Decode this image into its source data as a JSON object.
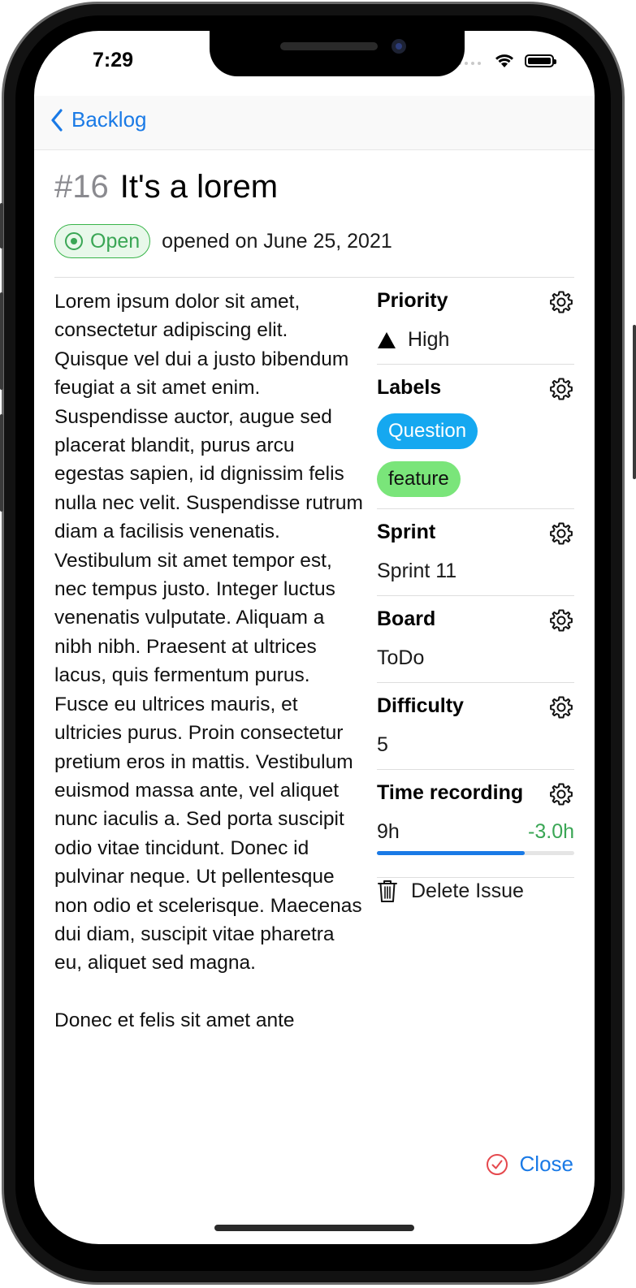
{
  "status_bar": {
    "time": "7:29"
  },
  "nav": {
    "back_label": "Backlog"
  },
  "issue": {
    "number": "#16",
    "title": "It's a lorem",
    "status": "Open",
    "opened_text": "opened on June 25, 2021",
    "body_paragraphs": [
      "Lorem ipsum dolor sit amet, consectetur adipiscing elit. Quisque vel dui a justo bibendum feugiat a sit amet enim. Suspendisse auctor, augue sed placerat blandit, purus arcu egestas sapien, id dignissim felis nulla nec velit. Suspendisse rutrum diam a facilisis venenatis. Vestibulum sit amet tempor est, nec tempus justo. Integer luctus venenatis vulputate. Aliquam a nibh nibh. Praesent at ultrices lacus, quis fermentum purus. Fusce eu ultrices mauris, et ultricies purus. Proin consectetur pretium eros in mattis. Vestibulum euismod massa ante, vel aliquet nunc iaculis a. Sed porta suscipit odio vitae tincidunt. Donec id pulvinar neque. Ut pellentesque non odio et scelerisque. Maecenas dui diam, suscipit vitae pharetra eu, aliquet sed magna.",
      "Donec et felis sit amet ante"
    ]
  },
  "sidebar": {
    "priority": {
      "title": "Priority",
      "value": "High",
      "icon": "triangle-icon"
    },
    "labels": {
      "title": "Labels",
      "items": [
        {
          "name": "Question",
          "color": "#15a8f0"
        },
        {
          "name": "feature",
          "color": "#7ae57a"
        }
      ]
    },
    "sprint": {
      "title": "Sprint",
      "value": "Sprint 11"
    },
    "board": {
      "title": "Board",
      "value": "ToDo"
    },
    "difficulty": {
      "title": "Difficulty",
      "value": "5"
    },
    "time_recording": {
      "title": "Time recording",
      "spent": "9h",
      "remaining": "-3.0h",
      "progress_fraction": 0.75
    },
    "delete_label": "Delete Issue"
  },
  "footer": {
    "close_label": "Close"
  },
  "colors": {
    "accent": "#1a7ae6",
    "open_green": "#3aa655",
    "danger_red": "#e5484d"
  }
}
